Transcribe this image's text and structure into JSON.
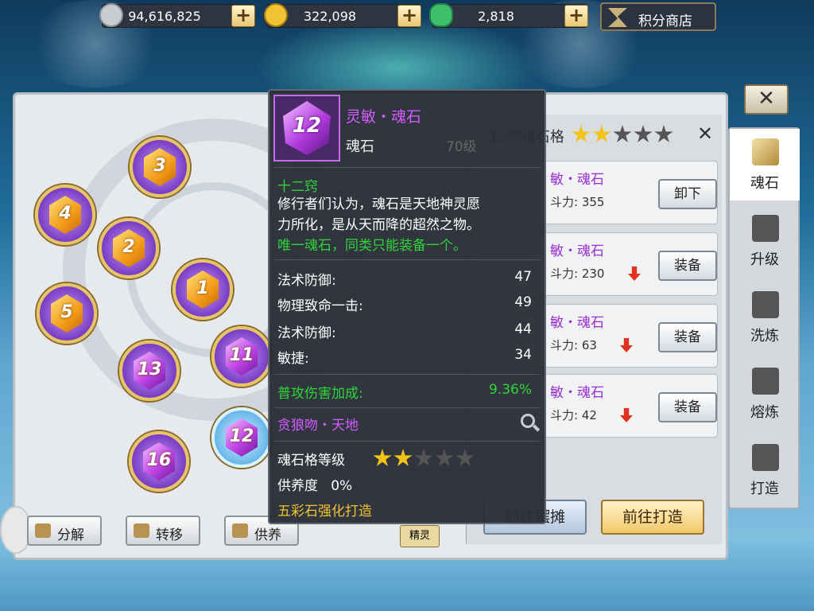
{
  "currencies": [
    {
      "value": "94,616,825",
      "icon": "silver-coin-icon",
      "color": "#c9ccd1"
    },
    {
      "value": "322,098",
      "icon": "gold-coin-icon",
      "color": "#f1c232"
    },
    {
      "value": "2,818",
      "icon": "jade-ingot-icon",
      "color": "#3fbf6a"
    }
  ],
  "plus_label": "+",
  "shop": {
    "label": "积分商店",
    "icon": "shop-flag-icon"
  },
  "close_label": "✕",
  "gems": [
    {
      "n": "3",
      "kind": "gold"
    },
    {
      "n": "4",
      "kind": "gold"
    },
    {
      "n": "2",
      "kind": "gold"
    },
    {
      "n": "1",
      "kind": "gold"
    },
    {
      "n": "5",
      "kind": "gold"
    },
    {
      "n": "13",
      "kind": "purple"
    },
    {
      "n": "11",
      "kind": "purple"
    },
    {
      "n": "12",
      "kind": "purple"
    },
    {
      "n": "16",
      "kind": "purple"
    }
  ],
  "bottom_buttons": [
    {
      "label": "分解",
      "icon": "decompose-icon"
    },
    {
      "label": "转移",
      "icon": "transfer-icon"
    },
    {
      "label": "供养",
      "icon": "nurture-icon"
    }
  ],
  "spirit_label": "精灵",
  "list": {
    "title": "12号魂石格",
    "stars": {
      "filled": 2,
      "total": 5
    },
    "close": "✕",
    "items": [
      {
        "name": "敏・魂石",
        "power": "斗力: 355",
        "action": "卸下",
        "arrow": false
      },
      {
        "name": "敏・魂石",
        "power": "斗力: 230",
        "action": "装备",
        "arrow": true
      },
      {
        "name": "敏・魂石",
        "power": "斗力: 63",
        "action": "装备",
        "arrow": true
      },
      {
        "name": "敏・魂石",
        "power": "斗力: 42",
        "action": "装备",
        "arrow": true
      }
    ],
    "btn_left": "前往摆摊",
    "btn_right": "前往打造"
  },
  "tabs": [
    {
      "label": "魂石",
      "icon": "soulstone-icon",
      "active": true
    },
    {
      "label": "升级",
      "icon": "upgrade-icon",
      "active": false
    },
    {
      "label": "洗炼",
      "icon": "refine-icon",
      "active": false
    },
    {
      "label": "熔炼",
      "icon": "smelt-icon",
      "active": false
    },
    {
      "label": "打造",
      "icon": "forge-icon",
      "active": false
    }
  ],
  "tooltip": {
    "gem_number": "12",
    "name": "灵敏・魂石",
    "type": "魂石",
    "level": "70级",
    "slot": "十二窍",
    "desc1": "修行者们认为，魂石是天地神灵愿",
    "desc2": "力所化，是从天而降的超然之物。",
    "unique": "唯一魂石，同类只能装备一个。",
    "stats": [
      {
        "label": "法术防御:",
        "value": "47"
      },
      {
        "label": "物理致命一击:",
        "value": "49"
      },
      {
        "label": "法术防御:",
        "value": "44"
      },
      {
        "label": "敏捷:",
        "value": "34"
      }
    ],
    "bonus_label": "普攻伤害加成:",
    "bonus_value": "9.36%",
    "set_name": "贪狼吻・天地",
    "grade_label": "魂石格等级",
    "grade_stars": {
      "filled": 2,
      "total": 5
    },
    "nurture": "供养度   0%",
    "forge_hint": "五彩石强化打造"
  }
}
